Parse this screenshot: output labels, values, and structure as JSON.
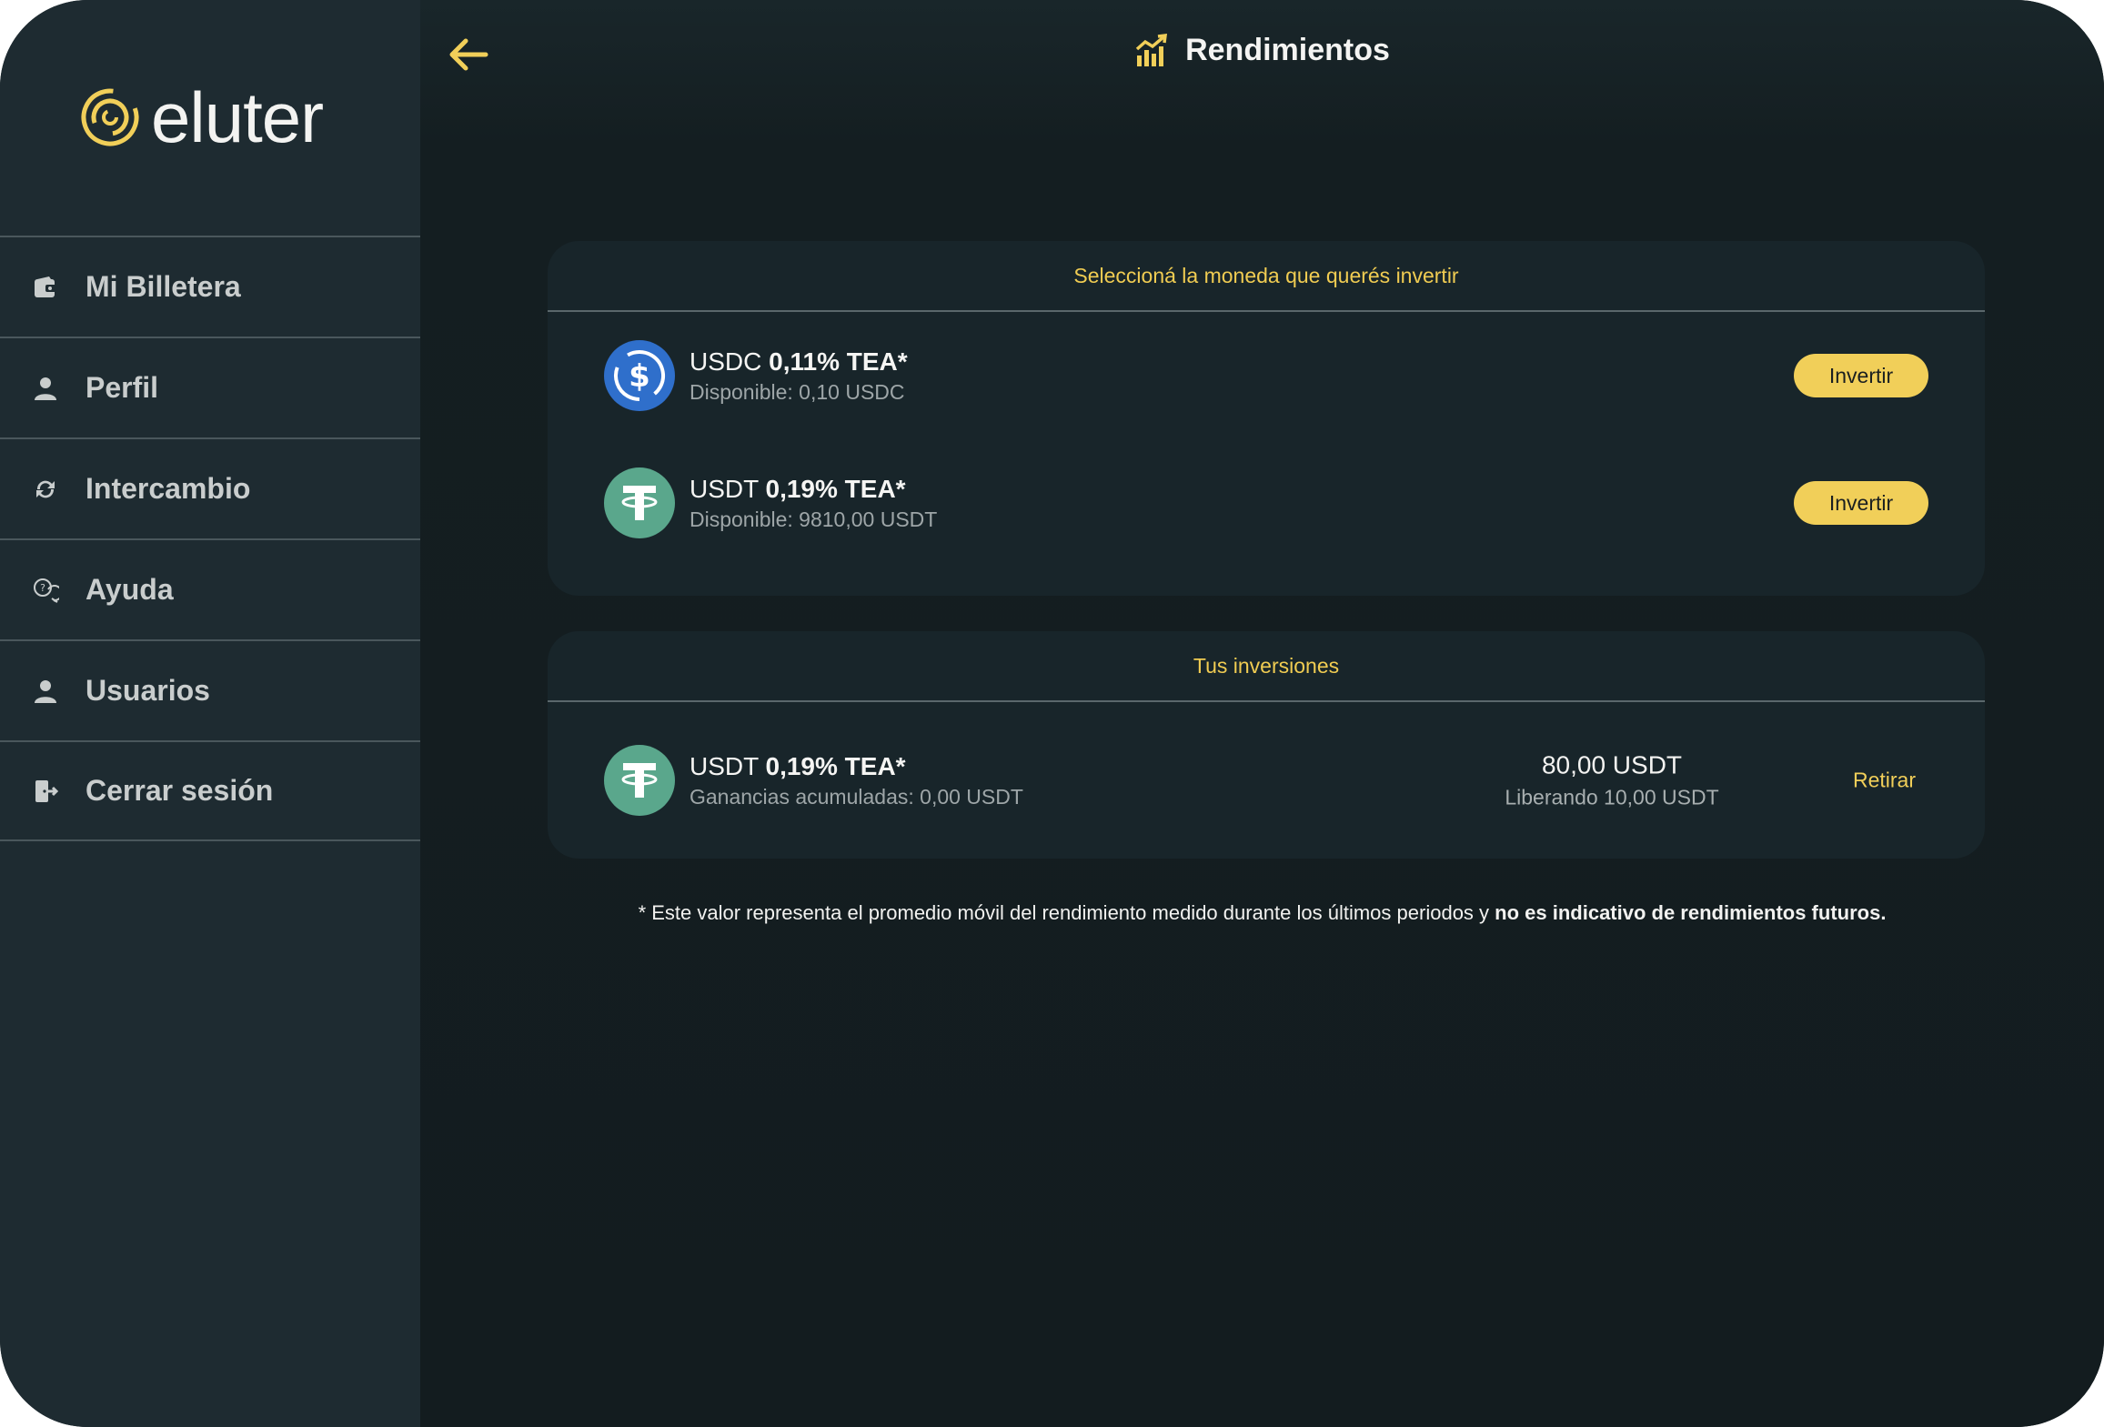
{
  "brand": {
    "name": "eluter",
    "accent": "#f1cf59"
  },
  "sidebar": {
    "items": [
      {
        "label": "Mi Billetera",
        "icon": "wallet-icon"
      },
      {
        "label": "Perfil",
        "icon": "user-icon"
      },
      {
        "label": "Intercambio",
        "icon": "exchange-icon"
      },
      {
        "label": "Ayuda",
        "icon": "help-chat-icon"
      },
      {
        "label": "Usuarios",
        "icon": "user-icon"
      },
      {
        "label": "Cerrar sesión",
        "icon": "logout-icon"
      }
    ]
  },
  "header": {
    "title": "Rendimientos",
    "icon": "chart-growth-icon",
    "back_icon": "arrow-left-icon"
  },
  "select_card": {
    "heading": "Seleccioná la moneda que querés invertir",
    "rows": [
      {
        "currency": "USDC",
        "rate": "0,11% TEA*",
        "available": "Disponible: 0,10 USDC",
        "button": "Invertir"
      },
      {
        "currency": "USDT",
        "rate": "0,19% TEA*",
        "available": "Disponible: 9810,00 USDT",
        "button": "Invertir"
      }
    ]
  },
  "investments_card": {
    "heading": "Tus inversiones",
    "rows": [
      {
        "currency": "USDT",
        "rate": "0,19% TEA*",
        "earnings": "Ganancias acumuladas: 0,00 USDT",
        "amount": "80,00 USDT",
        "releasing": "Liberando 10,00 USDT",
        "action": "Retirar"
      }
    ]
  },
  "footnote": {
    "text": "* Este valor representa el promedio móvil del rendimiento medido durante los últimos periodos y ",
    "bold": "no es indicativo de rendimientos futuros."
  }
}
